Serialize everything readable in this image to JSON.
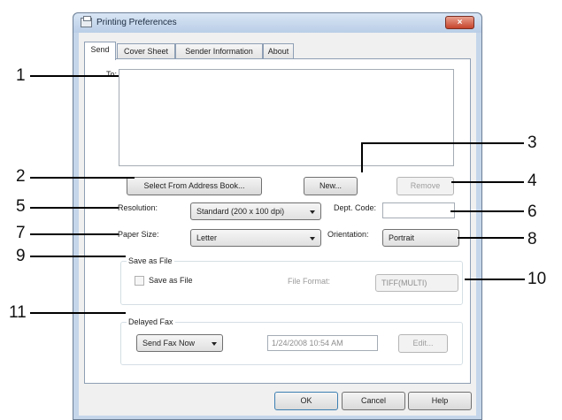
{
  "window": {
    "title": "Printing Preferences",
    "close_glyph": "×",
    "icon": "printer-icon"
  },
  "tabs": [
    "Send",
    "Cover Sheet",
    "Sender Information",
    "About"
  ],
  "send": {
    "to_label": "To:",
    "to_value": "",
    "select_address_book_label": "Select From Address Book...",
    "new_label": "New...",
    "remove_label": "Remove",
    "resolution_label": "Resolution:",
    "resolution_value": "Standard (200 x 100 dpi)",
    "dept_code_label": "Dept. Code:",
    "dept_code_value": "",
    "paper_size_label": "Paper Size:",
    "paper_size_value": "Letter",
    "orientation_label": "Orientation:",
    "orientation_value": "Portrait",
    "save_as_file_group": "Save as File",
    "save_as_file_checkbox": "Save as File",
    "save_as_file_checked": false,
    "file_format_label": "File Format:",
    "file_format_value": "TIFF(MULTI)",
    "delayed_fax_group": "Delayed Fax",
    "delayed_fax_value": "Send Fax Now",
    "delayed_datetime": "1/24/2008 10:54 AM",
    "edit_label": "Edit..."
  },
  "footer": {
    "ok_label": "OK",
    "cancel_label": "Cancel",
    "help_label": "Help"
  },
  "callouts": [
    "1",
    "2",
    "3",
    "4",
    "5",
    "6",
    "7",
    "8",
    "9",
    "10",
    "11"
  ]
}
